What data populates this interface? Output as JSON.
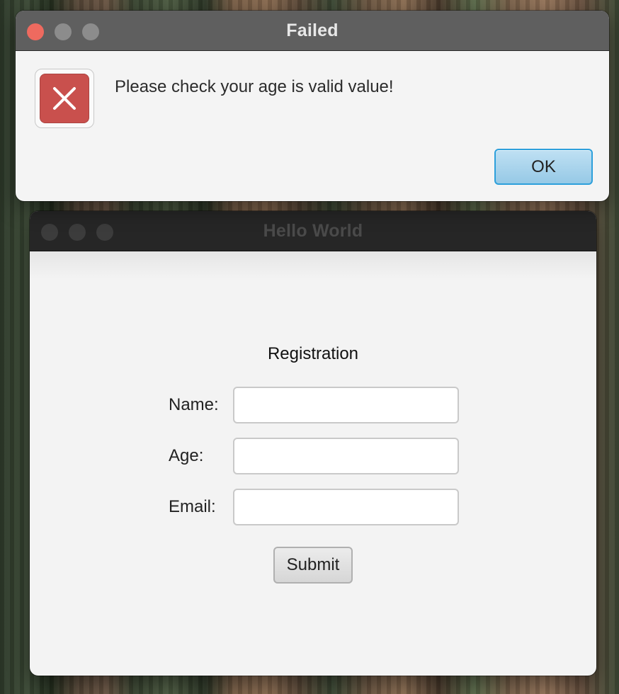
{
  "dialog": {
    "title": "Failed",
    "message": "Please check your age is valid value!",
    "ok_label": "OK",
    "icon": "error-x-icon",
    "accent_color": "#2ea0db",
    "error_color": "#c9504d"
  },
  "main_window": {
    "title": "Hello World",
    "form": {
      "heading": "Registration",
      "name_label": "Name:",
      "age_label": "Age:",
      "email_label": "Email:",
      "name_value": "",
      "age_value": "",
      "email_value": "",
      "submit_label": "Submit"
    }
  }
}
